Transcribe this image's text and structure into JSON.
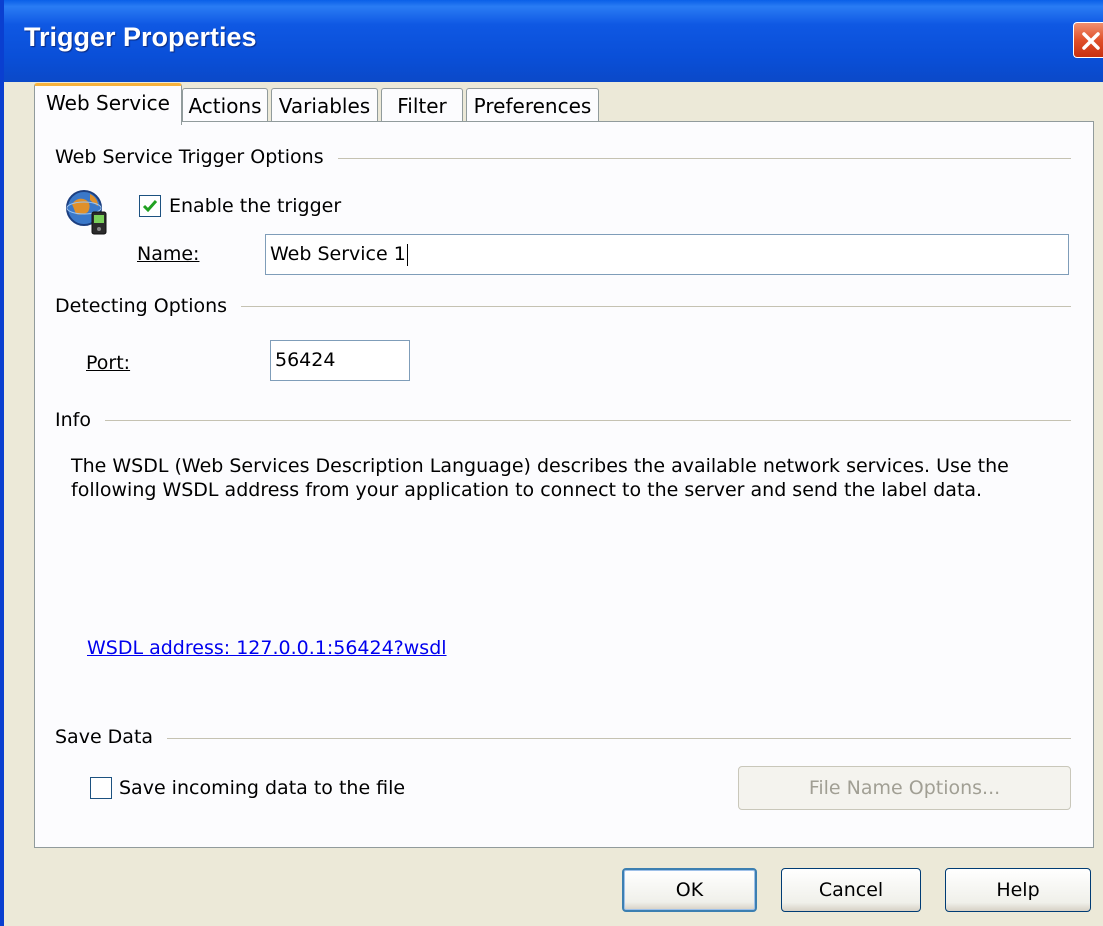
{
  "window": {
    "title": "Trigger Properties"
  },
  "tabs": [
    {
      "label": "Web Service",
      "active": true
    },
    {
      "label": "Actions",
      "active": false
    },
    {
      "label": "Variables",
      "active": false
    },
    {
      "label": "Filter",
      "active": false
    },
    {
      "label": "Preferences",
      "active": false
    }
  ],
  "web_service_options": {
    "section_title": "Web Service Trigger Options",
    "icon": "web-service-globe-icon",
    "enable_label": "Enable the trigger",
    "enable_checked": true,
    "name_label": "Name:",
    "name_value": "Web Service 1"
  },
  "detecting_options": {
    "section_title": "Detecting Options",
    "port_label": "Port:",
    "port_value": "56424"
  },
  "info": {
    "section_title": "Info",
    "description": "The WSDL (Web Services Description Language) describes the available network services. Use the following WSDL address from your application to connect to the server and send the label data.",
    "wsdl_link": "WSDL address: 127.0.0.1:56424?wsdl"
  },
  "save_data": {
    "section_title": "Save Data",
    "save_label": "Save incoming data to the file",
    "save_checked": false,
    "file_name_options_label": "File Name Options..."
  },
  "buttons": {
    "ok": "OK",
    "cancel": "Cancel",
    "help": "Help"
  },
  "colors": {
    "titlebar": "#0a4fd8",
    "active_tab_highlight": "#f7b23c",
    "link": "#0000ee",
    "dialog_bg": "#ece9d8"
  }
}
